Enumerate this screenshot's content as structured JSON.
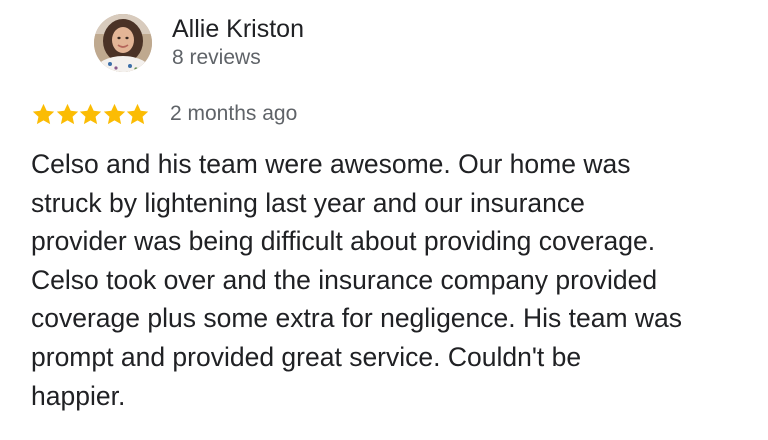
{
  "reviewer": {
    "name": "Allie Kriston",
    "review_count": "8 reviews",
    "avatar_icon": "user-photo-avatar"
  },
  "rating": {
    "stars": 5,
    "max": 5,
    "star_color": "#fbbc04",
    "star_icon": "star-icon"
  },
  "review": {
    "date": "2 months ago",
    "lines": [
      "Celso and his team were awesome. Our home was",
      "struck by lightening last year and our insurance",
      "provider was being difficult about providing coverage.",
      "Celso took over and the insurance company provided",
      "coverage plus some extra for negligence. His team was",
      "prompt and provided great service. Couldn't be",
      "happier."
    ]
  }
}
